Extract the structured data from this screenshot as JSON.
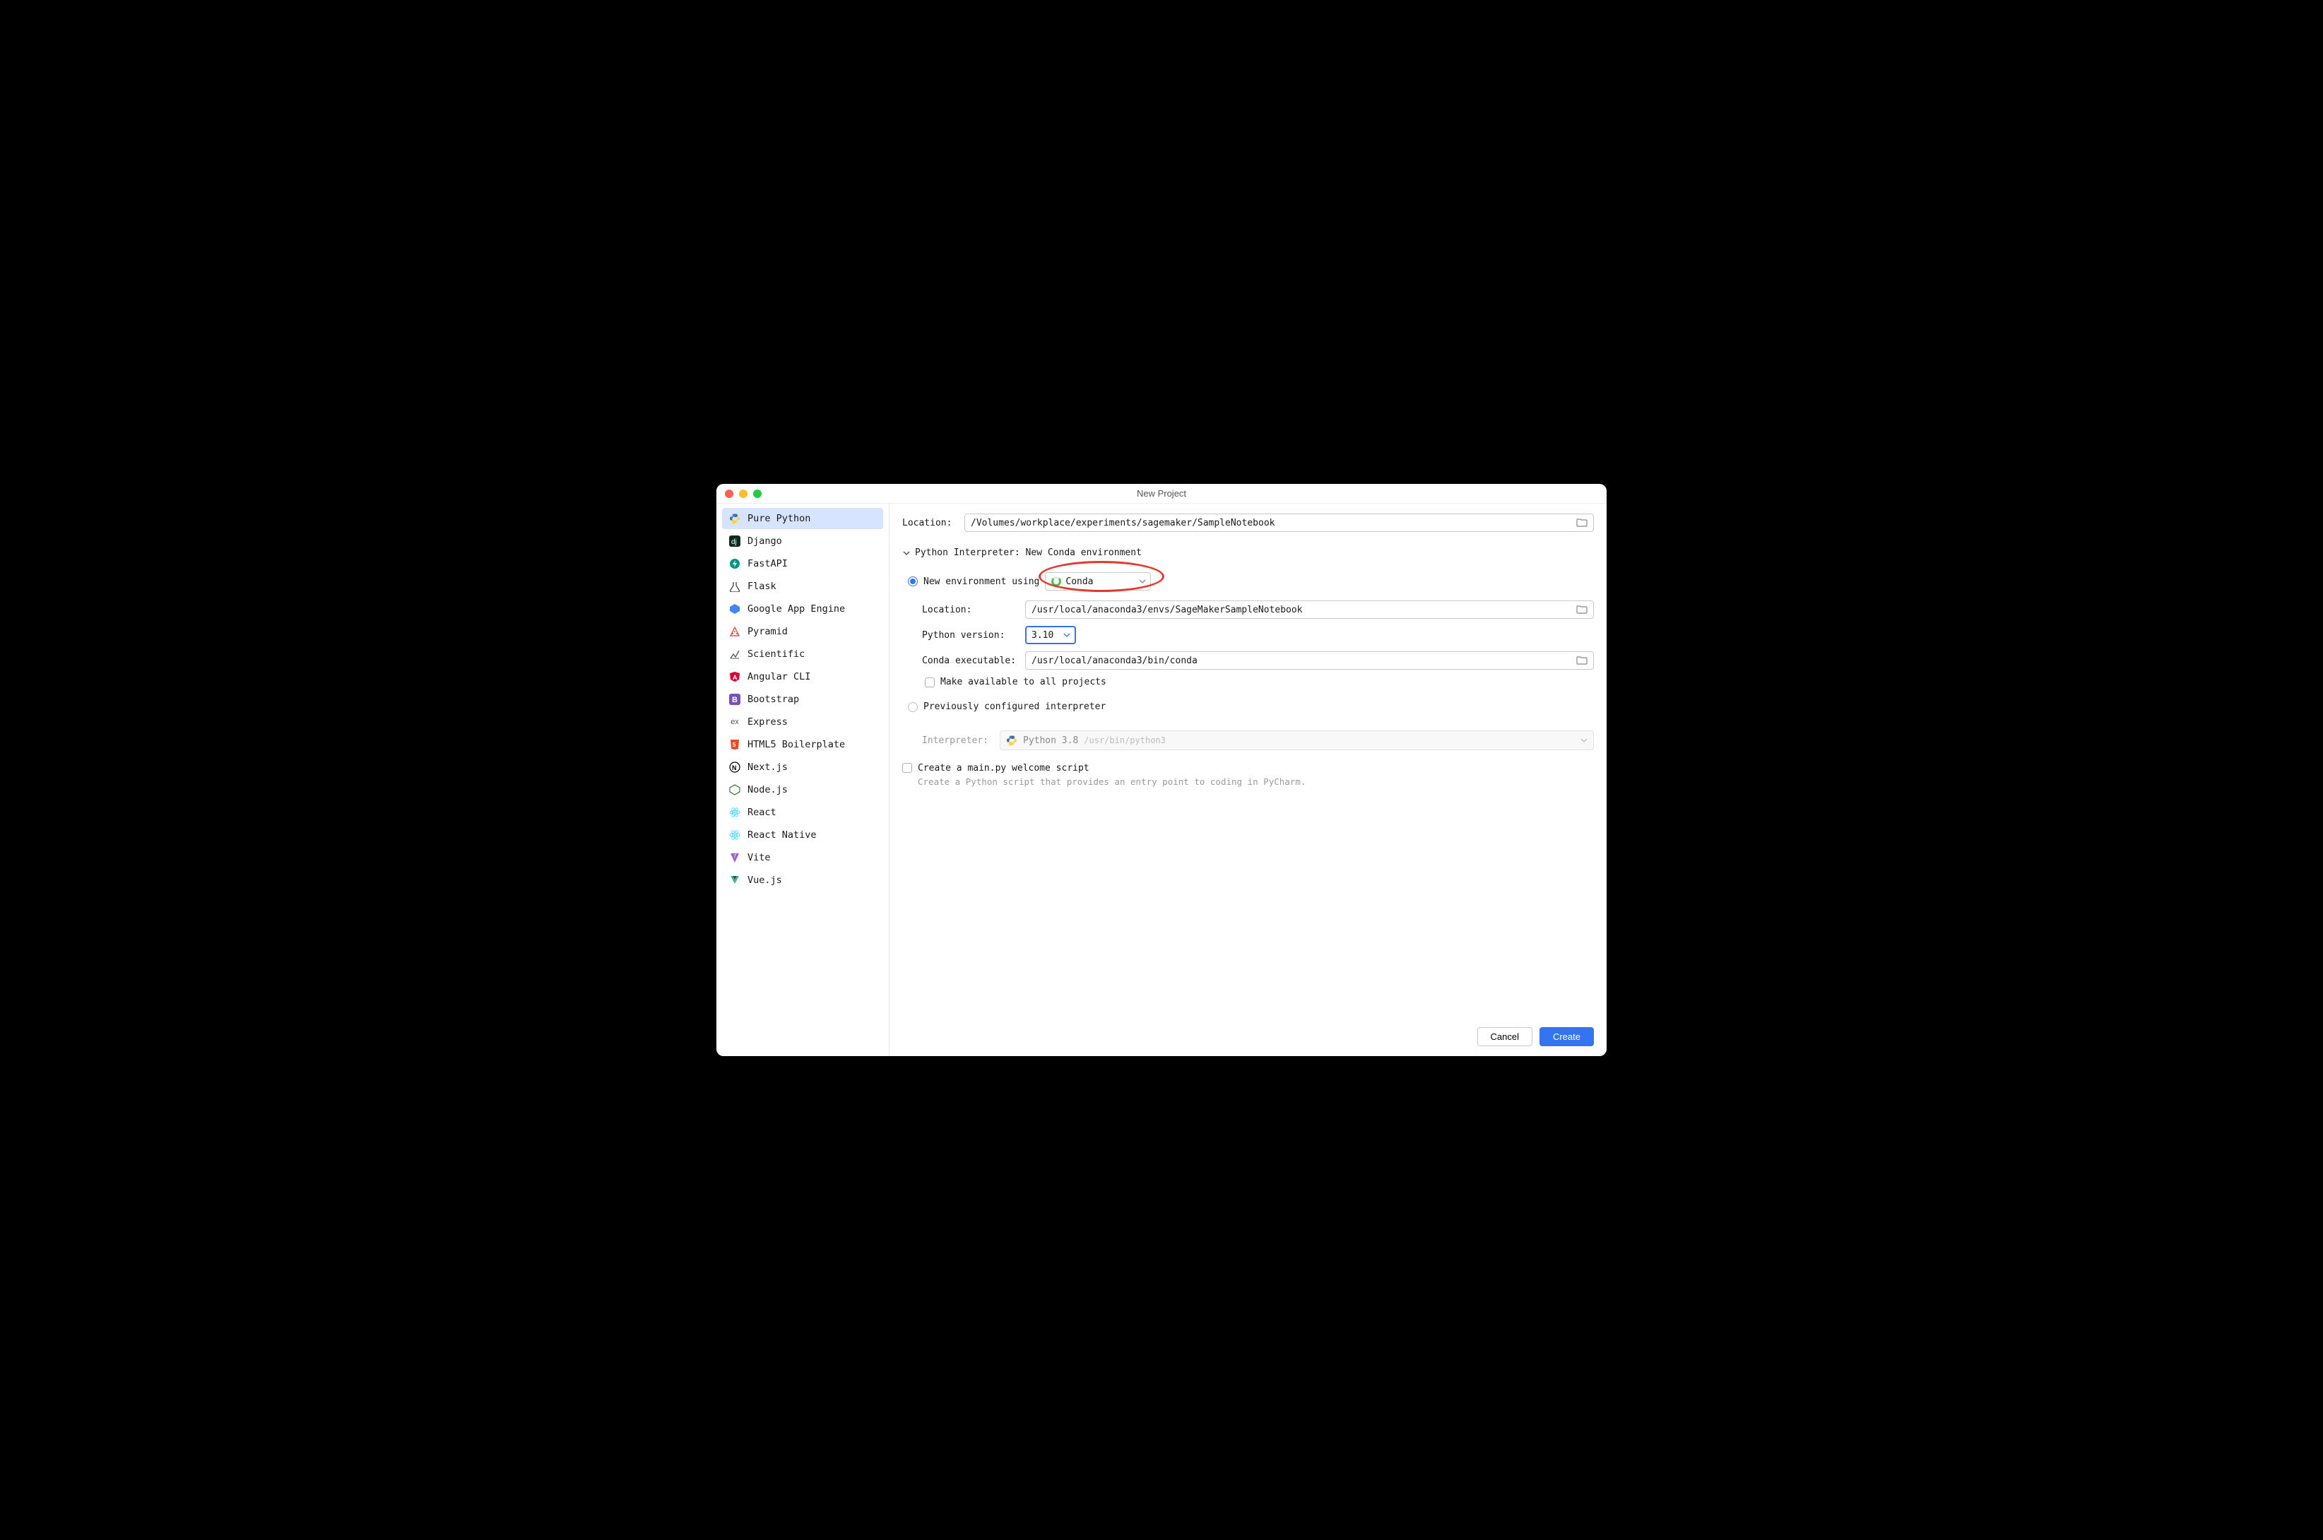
{
  "window": {
    "title": "New Project"
  },
  "sidebar": {
    "items": [
      {
        "label": "Pure Python"
      },
      {
        "label": "Django"
      },
      {
        "label": "FastAPI"
      },
      {
        "label": "Flask"
      },
      {
        "label": "Google App Engine"
      },
      {
        "label": "Pyramid"
      },
      {
        "label": "Scientific"
      },
      {
        "label": "Angular CLI"
      },
      {
        "label": "Bootstrap"
      },
      {
        "label": "Express"
      },
      {
        "label": "HTML5 Boilerplate"
      },
      {
        "label": "Next.js"
      },
      {
        "label": "Node.js"
      },
      {
        "label": "React"
      },
      {
        "label": "React Native"
      },
      {
        "label": "Vite"
      },
      {
        "label": "Vue.js"
      }
    ]
  },
  "form": {
    "location_label": "Location:",
    "location_value": "/Volumes/workplace/experiments/sagemaker/SampleNotebook",
    "section_label": "Python Interpreter: New Conda environment",
    "new_env_label": "New environment using",
    "env_tool": "Conda",
    "env_location_label": "Location:",
    "env_location_value": "/usr/local/anaconda3/envs/SageMakerSampleNotebook",
    "python_version_label": "Python version:",
    "python_version_value": "3.10",
    "conda_exec_label": "Conda executable:",
    "conda_exec_value": "/usr/local/anaconda3/bin/conda",
    "make_available_label": "Make available to all projects",
    "prev_configured_label": "Previously configured interpreter",
    "interpreter_label": "Interpreter:",
    "interpreter_value": "Python 3.8",
    "interpreter_path": "/usr/bin/python3",
    "create_main_label": "Create a main.py welcome script",
    "create_main_hint": "Create a Python script that provides an entry point to coding in PyCharm."
  },
  "buttons": {
    "cancel": "Cancel",
    "create": "Create"
  }
}
